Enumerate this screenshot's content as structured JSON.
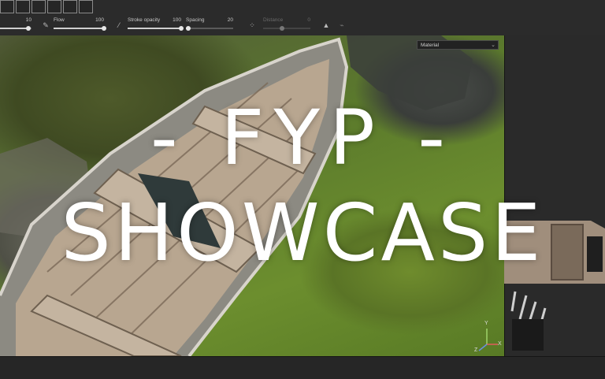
{
  "toolbar": {
    "slot_count": 6,
    "params": [
      {
        "id": "size",
        "label": "",
        "value": "10",
        "fraction": 0.9
      },
      {
        "id": "flow",
        "label": "Flow",
        "value": "100",
        "fraction": 1.0
      },
      {
        "id": "stroke_opacity",
        "label": "Stroke opacity",
        "value": "100",
        "fraction": 1.0
      },
      {
        "id": "spacing",
        "label": "Spacing",
        "value": "20",
        "fraction": 0.05
      },
      {
        "id": "distance",
        "label": "Distance",
        "value": "0",
        "fraction": 0.0,
        "disabled": true
      }
    ],
    "icons": [
      "brush-icon",
      "stroke-icon",
      "scatter-icon",
      "lazy-mouse-icon",
      "symmetry-icon",
      "pressure-icon"
    ]
  },
  "viewport": {
    "axis_labels": {
      "y": "Y",
      "x": "X",
      "z": "Z"
    },
    "colors": {
      "x": "#e25b5b",
      "y": "#9fd36a",
      "z": "#6a8fe0"
    }
  },
  "panel": {
    "material_select": "Material"
  },
  "overlay": {
    "line1": "- FYP -",
    "line2": "SHOWCASE"
  }
}
